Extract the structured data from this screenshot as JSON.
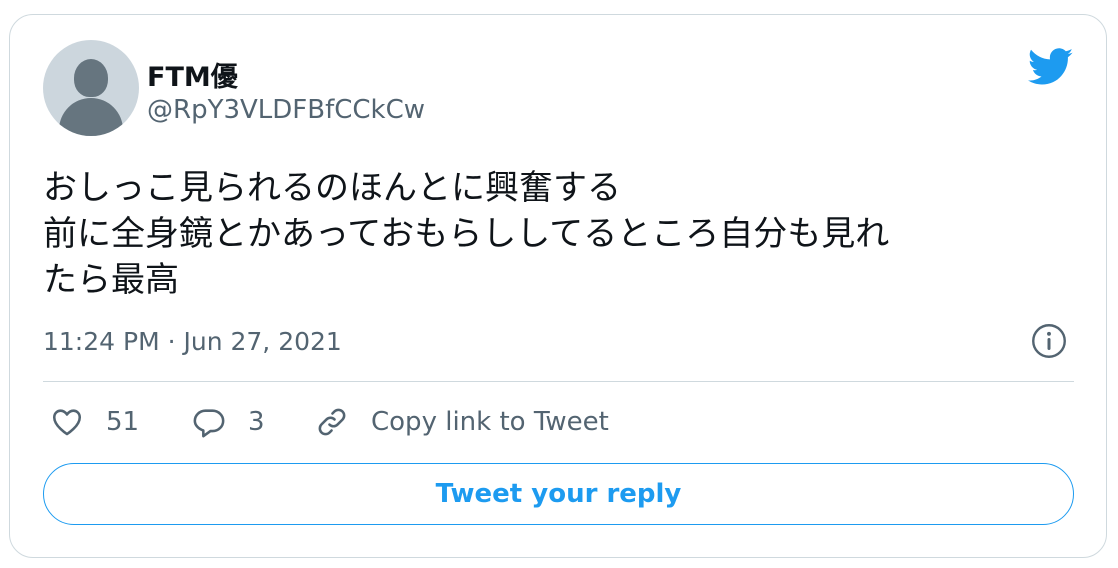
{
  "tweet": {
    "author_name": "FTM優",
    "author_handle": "@RpY3VLDFBfCCkCw",
    "text_lines": [
      "おしっこ見られるのほんとに興奮する",
      "前に全身鏡とかあっておもらししてるところ自分も見れ",
      "たら最高"
    ],
    "timestamp": "11:24 PM · Jun 27, 2021"
  },
  "actions": {
    "likes": "51",
    "replies": "3",
    "copy_link_label": "Copy link to Tweet"
  },
  "reply_button_label": "Tweet your reply",
  "colors": {
    "accent": "#1d9bf0",
    "text_primary": "#0f1419",
    "text_secondary": "#536471",
    "border": "#cfd9de"
  },
  "icons": [
    "twitter-bird-icon",
    "info-icon",
    "heart-icon",
    "reply-icon",
    "link-icon"
  ]
}
